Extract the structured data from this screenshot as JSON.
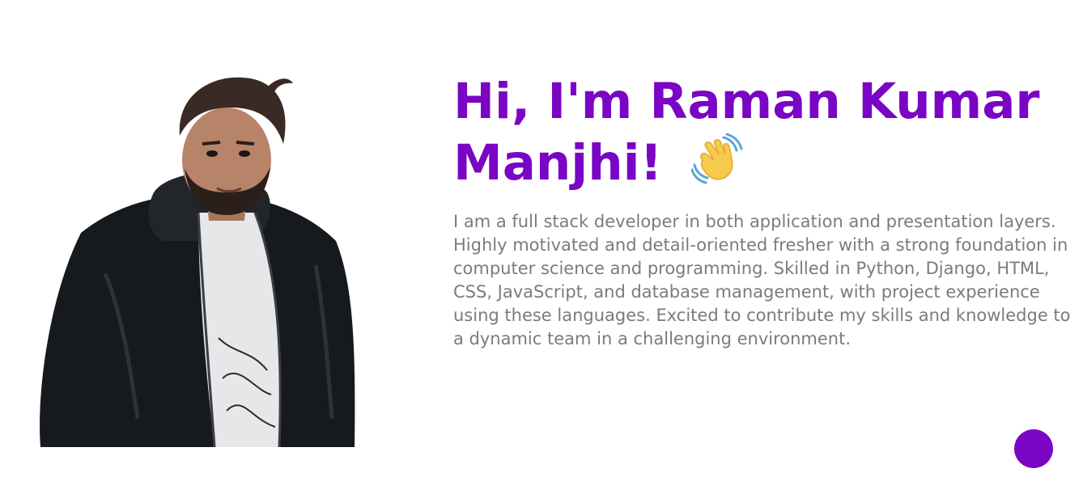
{
  "hero": {
    "headline_line1": "Hi, I'm Raman Kumar",
    "headline_line2": "Manjhi!",
    "wave_icon": "waving-hand-emoji",
    "bio": "I am a full stack developer in both application and presentation layers. Highly motivated and detail-oriented fresher with a strong foundation in computer science and programming. Skilled in Python, Django, HTML, CSS, JavaScript, and database management, with project experience using these languages. Excited to contribute my skills and knowledge to a dynamic team in a challenging environment.",
    "photo_icon": "profile-photo",
    "accent_color": "#7a05c4",
    "text_color": "#7b7b7b"
  },
  "fab": {
    "icon": "circle-button",
    "color": "#7a05c4"
  }
}
